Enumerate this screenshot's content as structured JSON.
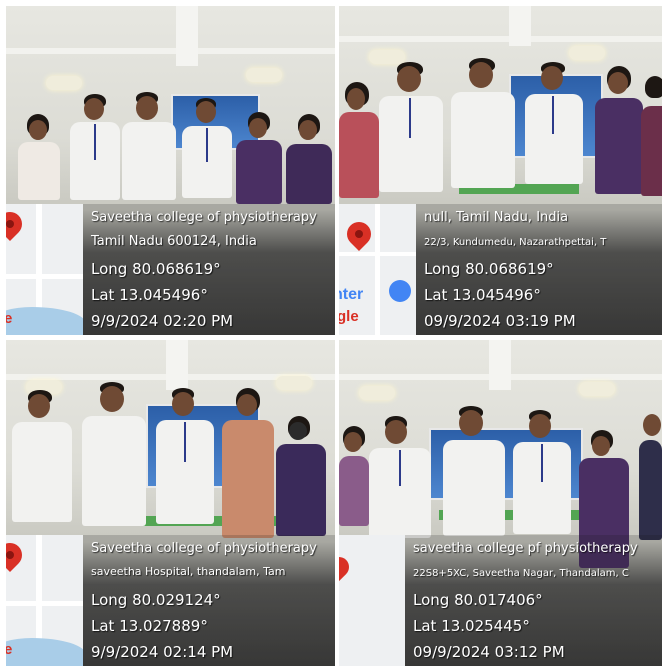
{
  "colors": {
    "overlay_text": "#ffffff",
    "map_pin": "#d93025",
    "map_water": "#a9cde8",
    "shirt_white": "#f2f2f0",
    "scrub_purple": "#4a2f63"
  },
  "panels": [
    {
      "location_line1": "Saveetha college of physiotherapy",
      "location_line2": "Tamil Nadu 600124, India",
      "long": "Long 80.068619°",
      "lat": "Lat 13.045496°",
      "timestamp": "9/9/2024 02:20 PM",
      "map_text": "e"
    },
    {
      "location_line1": "null, Tamil Nadu, India",
      "location_line2": "22/3, Kundumedu, Nazarathpettai, T",
      "long": "Long 80.068619°",
      "lat": "Lat 13.045496°",
      "timestamp": "09/9/2024 03:19 PM",
      "map_text_top": "nter",
      "map_text_bottom": "gle"
    },
    {
      "location_line1": "Saveetha college of physiotherapy",
      "location_line2": "saveetha Hospital, thandalam, Tam",
      "long": "Long 80.029124°",
      "lat": "Lat 13.027889°",
      "timestamp": "9/9/2024 02:14 PM",
      "map_text": "e"
    },
    {
      "location_line1": "saveetha college pf physiotherapy",
      "location_line2": "22S8+5XC, Saveetha Nagar, Thandalam, C",
      "long": "Long 80.017406°",
      "lat": "Lat 13.025445°",
      "timestamp": "09/9/2024 03:12 PM"
    }
  ]
}
